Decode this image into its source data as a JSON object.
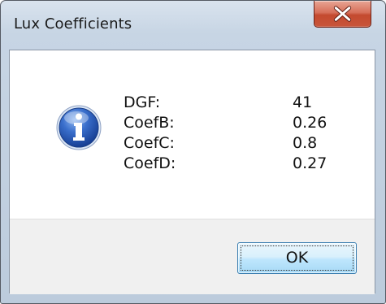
{
  "window": {
    "title": "Lux Coefficients",
    "close_glyph": "X"
  },
  "message": {
    "icon": "info-icon",
    "rows": [
      {
        "label": "DGF:",
        "value": "41"
      },
      {
        "label": "CoefB:",
        "value": "0.26"
      },
      {
        "label": "CoefC:",
        "value": "0.8"
      },
      {
        "label": "CoefD:",
        "value": "0.27"
      }
    ]
  },
  "buttons": {
    "ok_label": "OK"
  },
  "colors": {
    "close_button": "#c8553a",
    "info_icon": "#1f4fa8",
    "ok_border": "#3c7fb1"
  }
}
